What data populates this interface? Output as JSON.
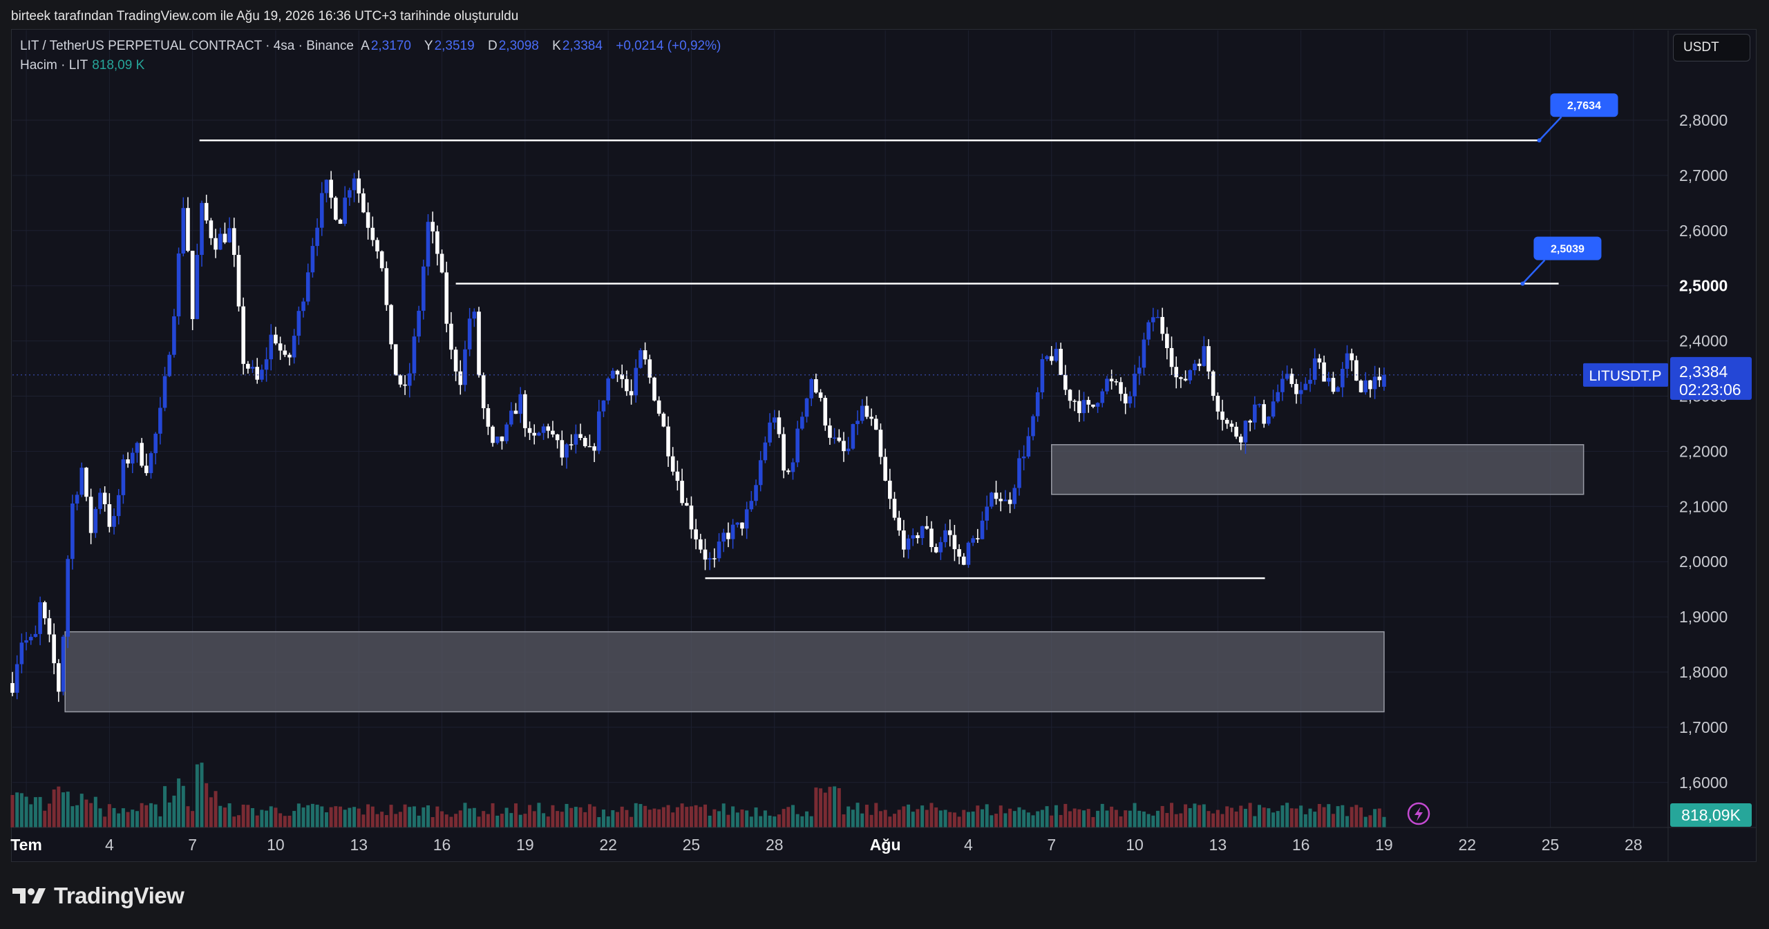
{
  "caption": "birteek tarafından TradingView.com ile Ağu 19, 2026 16:36 UTC+3 tarihinde oluşturuldu",
  "header": {
    "symbol": "LIT / TetherUS PERPETUAL CONTRACT · 4sa · Binance",
    "open_label": "A",
    "open": "2,3170",
    "high_label": "Y",
    "high": "2,3519",
    "low_label": "D",
    "low": "2,3098",
    "close_label": "K",
    "close": "2,3384",
    "change": "+0,0214 (+0,92%)"
  },
  "volume_header": {
    "label": "Hacim · LIT",
    "value": "818,09 K"
  },
  "currency_button": "USDT",
  "footer": {
    "brand": "TradingView"
  },
  "colors": {
    "up": "#2447d6",
    "down": "#ffffff",
    "vol_up": "#1f6f6a",
    "vol_down": "#7a2b33",
    "accent": "#2962ff",
    "zone": "#5a5c66"
  },
  "chart_data": {
    "type": "candlestick",
    "y_axis": {
      "min": 1.55,
      "max": 2.86,
      "ticks": [
        "2,8000",
        "2,7000",
        "2,6000",
        "2,5000",
        "2,4000",
        "2,3000",
        "2,2000",
        "2,1000",
        "2,0000",
        "1,9000",
        "1,8000",
        "1,7000",
        "1,6000"
      ],
      "tick_values": [
        2.8,
        2.7,
        2.6,
        2.5,
        2.4,
        2.3,
        2.2,
        2.1,
        2.0,
        1.9,
        1.8,
        1.7,
        1.6
      ]
    },
    "x_axis": {
      "range_days": [
        0,
        58.8
      ],
      "ticks": [
        {
          "day": 0.5,
          "label": "Tem"
        },
        {
          "day": 3.5,
          "label": "4"
        },
        {
          "day": 6.5,
          "label": "7"
        },
        {
          "day": 9.5,
          "label": "10"
        },
        {
          "day": 12.5,
          "label": "13"
        },
        {
          "day": 15.5,
          "label": "16"
        },
        {
          "day": 18.5,
          "label": "19"
        },
        {
          "day": 21.5,
          "label": "22"
        },
        {
          "day": 24.5,
          "label": "25"
        },
        {
          "day": 27.5,
          "label": "28"
        },
        {
          "day": 31.5,
          "label": "Ağu"
        },
        {
          "day": 34.5,
          "label": "4"
        },
        {
          "day": 37.5,
          "label": "7"
        },
        {
          "day": 40.5,
          "label": "10"
        },
        {
          "day": 43.5,
          "label": "13"
        },
        {
          "day": 46.5,
          "label": "16"
        },
        {
          "day": 49.5,
          "label": "19"
        },
        {
          "day": 52.5,
          "label": "22"
        },
        {
          "day": 55.5,
          "label": "25"
        },
        {
          "day": 58.5,
          "label": "28"
        }
      ]
    },
    "close_path": [
      [
        0,
        1.78
      ],
      [
        0.3,
        1.86
      ],
      [
        0.8,
        1.85
      ],
      [
        1.0,
        1.92
      ],
      [
        1.4,
        1.84
      ],
      [
        1.7,
        1.76
      ],
      [
        2.1,
        2.09
      ],
      [
        2.5,
        2.17
      ],
      [
        2.8,
        2.05
      ],
      [
        3.2,
        2.14
      ],
      [
        3.6,
        2.05
      ],
      [
        4.0,
        2.17
      ],
      [
        4.4,
        2.21
      ],
      [
        4.9,
        2.17
      ],
      [
        5.4,
        2.28
      ],
      [
        5.9,
        2.49
      ],
      [
        6.2,
        2.67
      ],
      [
        6.5,
        2.44
      ],
      [
        6.8,
        2.64
      ],
      [
        7.3,
        2.58
      ],
      [
        7.9,
        2.6
      ],
      [
        8.3,
        2.37
      ],
      [
        8.9,
        2.32
      ],
      [
        9.4,
        2.42
      ],
      [
        9.9,
        2.35
      ],
      [
        10.4,
        2.46
      ],
      [
        10.9,
        2.6
      ],
      [
        11.3,
        2.68
      ],
      [
        11.8,
        2.62
      ],
      [
        12.3,
        2.71
      ],
      [
        12.7,
        2.63
      ],
      [
        13.3,
        2.56
      ],
      [
        13.7,
        2.36
      ],
      [
        14.2,
        2.3
      ],
      [
        14.6,
        2.43
      ],
      [
        15.0,
        2.61
      ],
      [
        15.4,
        2.55
      ],
      [
        15.8,
        2.38
      ],
      [
        16.2,
        2.33
      ],
      [
        16.6,
        2.48
      ],
      [
        16.9,
        2.3
      ],
      [
        17.3,
        2.2
      ],
      [
        17.8,
        2.23
      ],
      [
        18.3,
        2.3
      ],
      [
        18.7,
        2.21
      ],
      [
        19.3,
        2.25
      ],
      [
        19.8,
        2.19
      ],
      [
        20.3,
        2.22
      ],
      [
        20.9,
        2.19
      ],
      [
        21.4,
        2.32
      ],
      [
        21.8,
        2.36
      ],
      [
        22.3,
        2.29
      ],
      [
        22.7,
        2.38
      ],
      [
        23.2,
        2.3
      ],
      [
        23.6,
        2.22
      ],
      [
        24.0,
        2.15
      ],
      [
        24.5,
        2.07
      ],
      [
        24.9,
        2.02
      ],
      [
        25.3,
        1.99
      ],
      [
        25.7,
        2.05
      ],
      [
        26.2,
        2.06
      ],
      [
        26.7,
        2.1
      ],
      [
        27.1,
        2.21
      ],
      [
        27.5,
        2.27
      ],
      [
        27.9,
        2.14
      ],
      [
        28.3,
        2.22
      ],
      [
        28.8,
        2.34
      ],
      [
        29.2,
        2.28
      ],
      [
        29.6,
        2.22
      ],
      [
        30.1,
        2.19
      ],
      [
        30.6,
        2.28
      ],
      [
        31.1,
        2.24
      ],
      [
        31.5,
        2.14
      ],
      [
        31.9,
        2.06
      ],
      [
        32.4,
        2.02
      ],
      [
        32.8,
        2.07
      ],
      [
        33.3,
        2.02
      ],
      [
        33.7,
        2.06
      ],
      [
        34.2,
        2.0
      ],
      [
        34.6,
        2.03
      ],
      [
        35.1,
        2.08
      ],
      [
        35.5,
        2.13
      ],
      [
        35.9,
        2.1
      ],
      [
        36.4,
        2.19
      ],
      [
        36.8,
        2.24
      ],
      [
        37.2,
        2.36
      ],
      [
        37.6,
        2.38
      ],
      [
        38.0,
        2.31
      ],
      [
        38.4,
        2.29
      ],
      [
        38.9,
        2.27
      ],
      [
        39.4,
        2.33
      ],
      [
        39.9,
        2.31
      ],
      [
        40.3,
        2.28
      ],
      [
        40.8,
        2.39
      ],
      [
        41.2,
        2.45
      ],
      [
        41.7,
        2.4
      ],
      [
        42.1,
        2.31
      ],
      [
        42.6,
        2.36
      ],
      [
        43.0,
        2.38
      ],
      [
        43.4,
        2.3
      ],
      [
        43.9,
        2.24
      ],
      [
        44.3,
        2.23
      ],
      [
        44.8,
        2.28
      ],
      [
        45.2,
        2.26
      ],
      [
        45.7,
        2.31
      ],
      [
        46.1,
        2.33
      ],
      [
        46.6,
        2.3
      ],
      [
        47.0,
        2.36
      ],
      [
        47.4,
        2.34
      ],
      [
        47.8,
        2.31
      ],
      [
        48.2,
        2.37
      ],
      [
        48.6,
        2.32
      ],
      [
        49.0,
        2.33
      ],
      [
        49.3,
        2.31
      ],
      [
        49.6,
        2.34
      ]
    ],
    "overlays": {
      "horizontal_lines": [
        {
          "price": 2.7634,
          "from_day": 6.75,
          "to_day": 55.1
        },
        {
          "price": 2.5039,
          "from_day": 16.0,
          "to_day": 55.8
        },
        {
          "price": 1.97,
          "from_day": 25.0,
          "to_day": 45.2
        }
      ],
      "zones": [
        {
          "top": 2.212,
          "bottom": 2.122,
          "from_day": 37.5,
          "to_day": 56.7
        },
        {
          "top": 1.873,
          "bottom": 1.728,
          "from_day": 1.9,
          "to_day": 49.5
        }
      ],
      "labels": [
        {
          "text": "2,7634",
          "price": 2.7634,
          "day": 55.1
        },
        {
          "text": "2,5039",
          "price": 2.5039,
          "day": 54.5
        }
      ]
    },
    "price_labels": {
      "last_value": "2,3384",
      "countdown": "02:23:06",
      "symbol_tag": "LITUSDT.P",
      "volume_value": "818,09K"
    }
  }
}
